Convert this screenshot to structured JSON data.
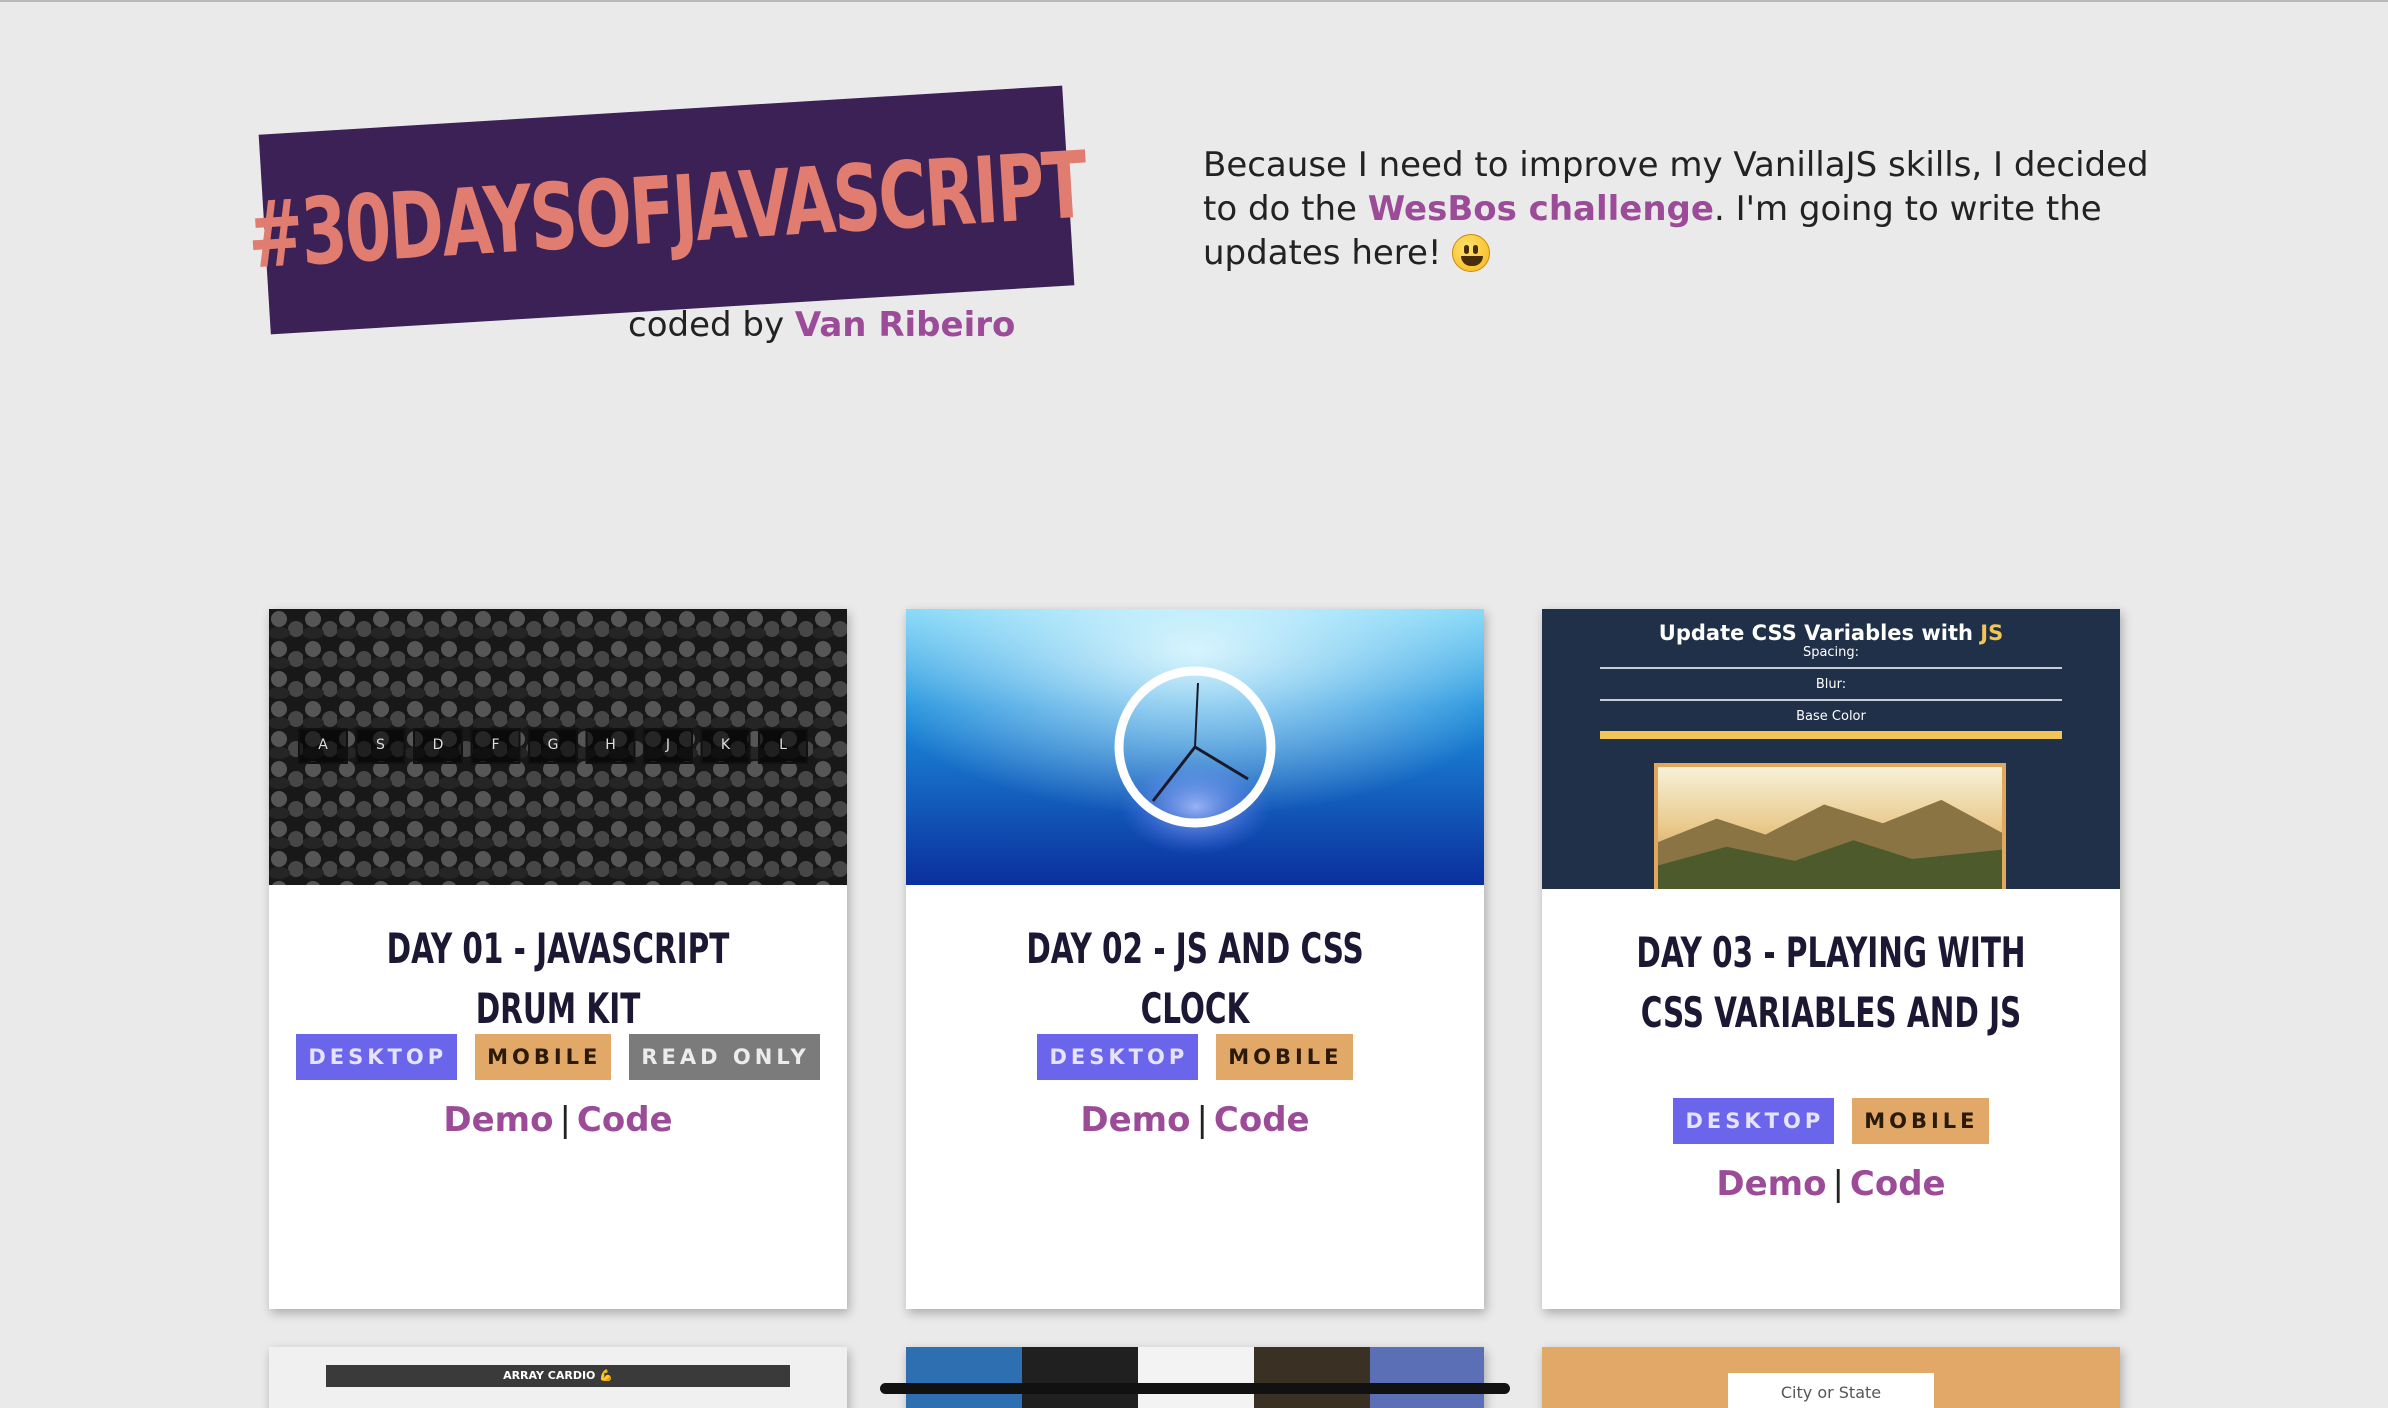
{
  "header": {
    "banner_title": "#30DAYSOFJAVASCRIPT",
    "credit_prefix": "coded by",
    "credit_author": "Van Ribeiro",
    "intro_part1": "Because I need to improve my VanillaJS skills, I decided to do the",
    "intro_link": "WesBos challenge",
    "intro_part2": ". I'm going to write the updates here!",
    "intro_emoji": "grinning-face-emoji"
  },
  "cards": [
    {
      "title": "DAY 01 - JAVASCRIPT DRUM KIT",
      "tags": [
        "DESKTOP",
        "MOBILE",
        "READ ONLY"
      ],
      "demo_label": "Demo",
      "separator": "|",
      "code_label": "Code",
      "thumb_keys": [
        "A",
        "S",
        "D",
        "F",
        "G",
        "H",
        "J",
        "K",
        "L"
      ]
    },
    {
      "title": "DAY 02 - JS AND CSS CLOCK",
      "tags": [
        "DESKTOP",
        "MOBILE"
      ],
      "demo_label": "Demo",
      "separator": "|",
      "code_label": "Code"
    },
    {
      "title": "DAY 03 - PLAYING WITH CSS VARIABLES AND JS",
      "tags": [
        "DESKTOP",
        "MOBILE"
      ],
      "demo_label": "Demo",
      "separator": "|",
      "code_label": "Code",
      "thumb_heading": "Update CSS Variables with",
      "thumb_heading_js": "JS",
      "thumb_spacing": "Spacing:",
      "thumb_blur": "Blur:",
      "thumb_base_color": "Base Color"
    }
  ],
  "partial_cards": {
    "card4_heading": "ARRAY CARDIO 💪",
    "card6_input_placeholder": "City or State"
  },
  "colors": {
    "background": "#eaeaea",
    "banner_bg": "#3b2155",
    "banner_text": "#e07c70",
    "link": "#9b4b98",
    "tag_desktop": "#6b65ec",
    "tag_mobile": "#e2a867",
    "tag_readonly": "#7b7b7b"
  }
}
